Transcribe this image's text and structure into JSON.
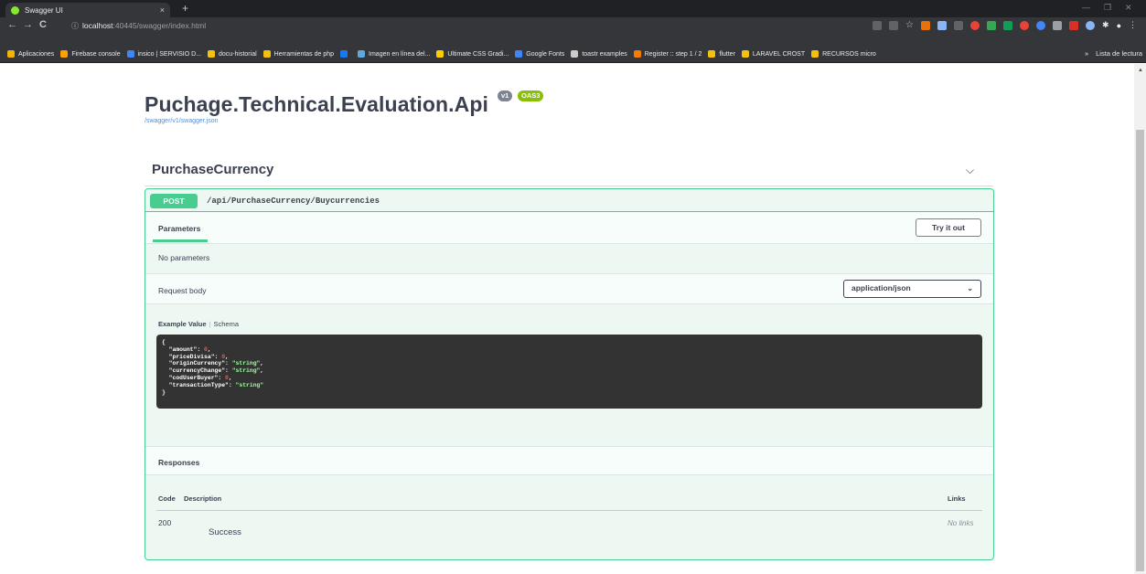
{
  "browser": {
    "tab_title": "Swagger UI",
    "tab_close": "×",
    "new_tab": "+",
    "url_host": "localhost",
    "url_path": ":40445/swagger/index.html",
    "bookmarks": [
      {
        "label": "Aplicaciones",
        "color": "#f4b400"
      },
      {
        "label": "Firebase console",
        "color": "#ffa000"
      },
      {
        "label": "insico | SERVISIO D...",
        "color": "#4285f4"
      },
      {
        "label": "docu-historial",
        "color": "#f4c20d"
      },
      {
        "label": "Herramientas de php",
        "color": "#f4c20d"
      },
      {
        "label": "",
        "color": "#1877f2"
      },
      {
        "label": "Imagen en línea del...",
        "color": "#5fa9dd"
      },
      {
        "label": "Ultimate CSS Gradi...",
        "color": "#ffcc00"
      },
      {
        "label": "Google Fonts",
        "color": "#4285f4"
      },
      {
        "label": "toastr examples",
        "color": "#cccccc"
      },
      {
        "label": "Register :: step 1 / 2",
        "color": "#f57c00"
      },
      {
        "label": "flutter",
        "color": "#f4c20d"
      },
      {
        "label": "LARAVEL CROST",
        "color": "#f4c20d"
      },
      {
        "label": "RECURSOS micro",
        "color": "#f4c20d"
      }
    ],
    "bookmarks_more": "»",
    "reading_list": "Lista de lectura"
  },
  "api": {
    "title": "Puchage.Technical.Evaluation.Api",
    "version_badge": "v1",
    "oas_badge": "OAS3",
    "spec_url": "/swagger/v1/swagger.json"
  },
  "tag": {
    "name": "PurchaseCurrency",
    "chevron": "⌵"
  },
  "operation": {
    "method": "POST",
    "path": "/api/PurchaseCurrency/Buycurrencies",
    "parameters_tab": "Parameters",
    "try_button": "Try it out",
    "no_parameters": "No parameters",
    "request_body_label": "Request body",
    "content_type": "application/json",
    "example_tab": "Example Value",
    "separator": "|",
    "schema_tab": "Schema",
    "example_lines": [
      {
        "key": "{",
        "value": "",
        "kind": "none",
        "suffix": ""
      },
      {
        "key": "  \"amount\": ",
        "value": "0",
        "kind": "num",
        "suffix": ","
      },
      {
        "key": "  \"priceDivisa\": ",
        "value": "0",
        "kind": "num",
        "suffix": ","
      },
      {
        "key": "  \"originCurrency\": ",
        "value": "\"string\"",
        "kind": "str",
        "suffix": ","
      },
      {
        "key": "  \"currencyChange\": ",
        "value": "\"string\"",
        "kind": "str",
        "suffix": ","
      },
      {
        "key": "  \"codUserBuyer\": ",
        "value": "0",
        "kind": "num",
        "suffix": ","
      },
      {
        "key": "  \"transactionType\": ",
        "value": "\"string\"",
        "kind": "str",
        "suffix": ""
      },
      {
        "key": "}",
        "value": "",
        "kind": "none",
        "suffix": ""
      }
    ]
  },
  "responses": {
    "title": "Responses",
    "col_code": "Code",
    "col_description": "Description",
    "col_links": "Links",
    "rows": [
      {
        "code": "200",
        "description": "Success",
        "links": "No links"
      }
    ]
  }
}
